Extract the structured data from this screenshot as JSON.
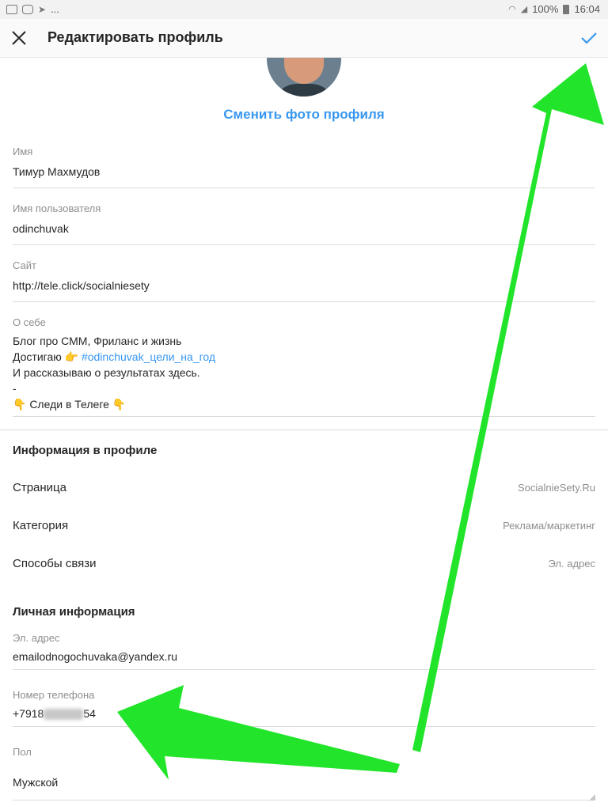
{
  "status_bar": {
    "dots": "...",
    "battery": "100%",
    "time": "16:04"
  },
  "header": {
    "title": "Редактировать профиль"
  },
  "profile": {
    "change_photo": "Сменить фото профиля"
  },
  "fields": {
    "name": {
      "label": "Имя",
      "value": "Тимур Махмудов"
    },
    "username": {
      "label": "Имя пользователя",
      "value": "odinchuvak"
    },
    "site": {
      "label": "Сайт",
      "value": "http://tele.click/socialniesety"
    },
    "bio": {
      "label": "О себе",
      "line1": "Блог про СММ, Фриланс и жизнь",
      "line2_prefix": "Достигаю 👉 ",
      "line2_tag": "#odinchuvak_цели_на_год",
      "line3": "И рассказываю о результатах здесь.",
      "line4": "-",
      "line5": "👇 Следи в Телеге 👇"
    }
  },
  "profile_info": {
    "title": "Информация в профиле",
    "rows": [
      {
        "label": "Страница",
        "value": "SocialnieSety.Ru"
      },
      {
        "label": "Категория",
        "value": "Реклама/маркетинг"
      },
      {
        "label": "Способы связи",
        "value": "Эл. адрес"
      }
    ]
  },
  "personal_info": {
    "title": "Личная информация",
    "email": {
      "label": "Эл. адрес",
      "value": "emailodnogochuvaka@yandex.ru"
    },
    "phone": {
      "label": "Номер телефона",
      "prefix": "+7918",
      "suffix": "54"
    },
    "gender": {
      "label": "Пол",
      "value": "Мужской"
    }
  },
  "colors": {
    "accent": "#3897f0",
    "arrow": "#22e52b"
  }
}
